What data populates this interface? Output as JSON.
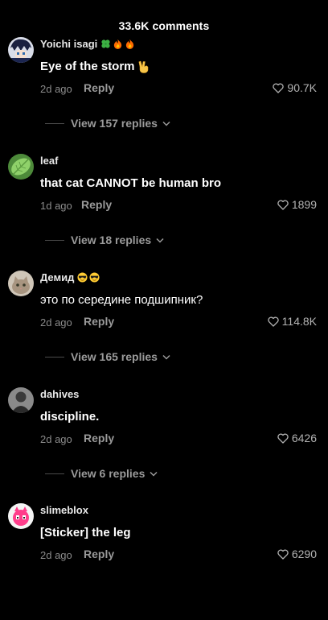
{
  "header": {
    "title": "33.6K comments"
  },
  "comments": [
    {
      "username": "Yoichi isagi",
      "user_badges": [
        "clover-emoji",
        "fire-emoji",
        "fire-emoji"
      ],
      "text": "Eye of the storm",
      "text_emoji": "victory-hand-emoji",
      "age": "2d ago",
      "reply_label": "Reply",
      "likes": "90.7K",
      "view_replies": "View 157 replies",
      "avatar": "anime-character-avatar"
    },
    {
      "username": "leaf",
      "user_badges": [],
      "text": "that cat CANNOT be human bro",
      "text_emoji": "",
      "age": "1d ago",
      "reply_label": "Reply",
      "likes": "1899",
      "view_replies": "View 18 replies",
      "avatar": "leaf-avatar"
    },
    {
      "username": "Демид",
      "user_badges": [
        "sunglasses-emoji",
        "sunglasses-emoji"
      ],
      "text": "это по середине подшипник?",
      "text_emoji": "",
      "age": "2d ago",
      "reply_label": "Reply",
      "likes": "114.8K",
      "view_replies": "View 165 replies",
      "avatar": "cat-photo-avatar"
    },
    {
      "username": "dahives",
      "user_badges": [],
      "text": "discipline.",
      "text_emoji": "",
      "age": "2d ago",
      "reply_label": "Reply",
      "likes": "6426",
      "view_replies": "View 6 replies",
      "avatar": "dark-portrait-avatar"
    },
    {
      "username": "slimeblox",
      "user_badges": [],
      "text": "[Sticker] the leg",
      "text_emoji": "",
      "age": "2d ago",
      "reply_label": "Reply",
      "likes": "6290",
      "view_replies": "",
      "avatar": "pink-character-avatar"
    }
  ],
  "colors": {
    "background": "#000000",
    "primary_text": "#ffffff",
    "secondary_text": "#8a8a8a",
    "reply_text": "#9a9a9a"
  }
}
